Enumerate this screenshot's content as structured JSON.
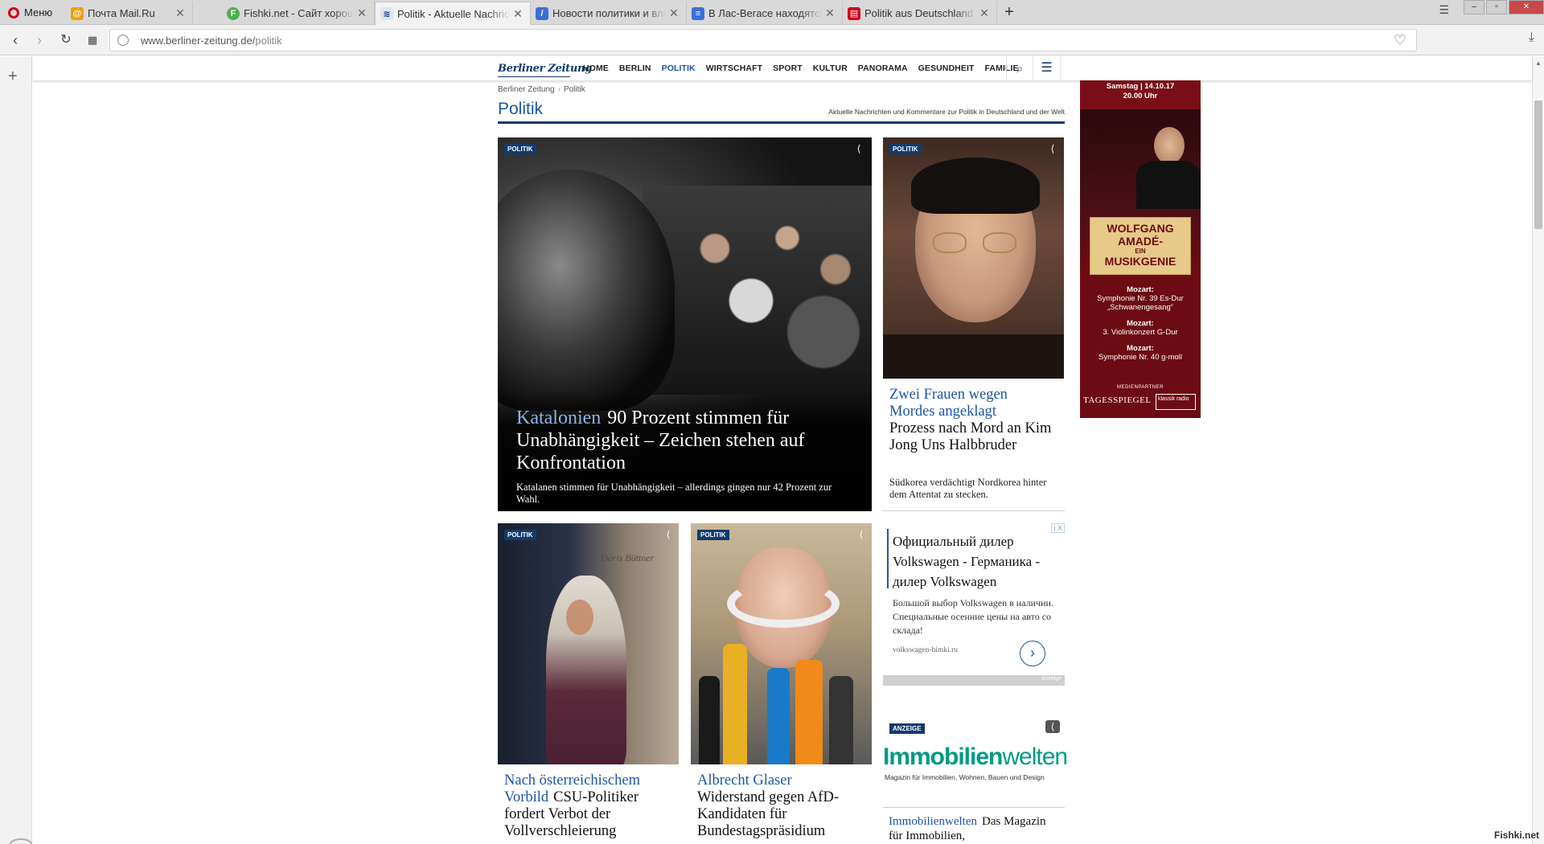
{
  "browser": {
    "menu_label": "Меню",
    "tabs": [
      {
        "title": "Почта Mail.Ru",
        "fav_color": "#f0a000"
      },
      {
        "title": "Fishki.net - Сайт хорошего",
        "fav_color": "#4caf50",
        "fav_letter": "F"
      },
      {
        "title": "Politik - Aktuelle Nachrichten",
        "fav_color": "#123b6d"
      },
      {
        "title": "Новости политики и власти",
        "fav_color": "#3b6fd8",
        "fav_letter": "/"
      },
      {
        "title": "В Лас-Вегасе находятся",
        "fav_color": "#3b6fd8"
      },
      {
        "title": "Politik aus Deutschland und",
        "fav_color": "#d0021b"
      }
    ],
    "url_host": "www.berliner-zeitung.de/",
    "url_path": "politik",
    "watermark": "Fishki.net"
  },
  "site": {
    "logo": "Berliner Zeitung",
    "nav": [
      "HOME",
      "BERLIN",
      "POLITIK",
      "WIRTSCHAFT",
      "SPORT",
      "KULTUR",
      "PANORAMA",
      "GESUNDHEIT",
      "FAMILIE"
    ],
    "breadcrumb": [
      "Berliner Zeitung",
      "Politik"
    ],
    "section_title": "Politik",
    "section_subtitle": "Aktuelle Nachrichten und Kommentare zur Politik in Deutschland und der Welt"
  },
  "articles": {
    "hero": {
      "tag": "POLITIK",
      "kicker": "Katalonien",
      "title": "90 Prozent stimmen für Unabhängigkeit – Zeichen stehen auf Konfrontation",
      "teaser": "Katalanen stimmen für Unabhängigkeit – allerdings gingen nur 42 Prozent zur Wahl."
    },
    "kim": {
      "tag": "POLITIK",
      "kicker": "Zwei Frauen wegen Mordes angeklagt",
      "title": "Prozess nach Mord an Kim Jong Uns Halbbruder",
      "teaser": "Südkorea verdächtigt Nordkorea hinter dem Attentat zu stecken."
    },
    "burka": {
      "tag": "POLITIK",
      "kicker": "Nach österreichischem Vorbild",
      "title": "CSU-Politiker fordert Verbot der Vollverschleierung",
      "shop_sign": "Doris Büttner"
    },
    "glaser": {
      "tag": "POLITIK",
      "kicker": "Albrecht Glaser",
      "title": "Widerstand gegen AfD-Kandidaten für Bundestagspräsidium"
    }
  },
  "ads": {
    "vw": {
      "headline": "Официальный дилер Volkswagen - Германика - дилер Volkswagen",
      "text": "Большой выбор Volkswagen в наличии. Специальные осенние цены на авто со склада!",
      "domain": "volkswagen-himki.ru",
      "footer": "Anzeige",
      "choice": "i X"
    },
    "concert": {
      "date": "Samstag | 14.10.17",
      "time": "20.00 Uhr",
      "headline_1": "WOLFGANG",
      "headline_2": "AMADÉ-",
      "headline_ein": "EIN",
      "headline_3": "MUSIKGENIE",
      "program": [
        {
          "composer": "Mozart:",
          "work": "Symphonie Nr. 39 Es-Dur „Schwanengesang“"
        },
        {
          "composer": "Mozart:",
          "work": "3. Violinkonzert G-Dur"
        },
        {
          "composer": "Mozart:",
          "work": "Symphonie Nr. 40 g-moll"
        }
      ],
      "partner_label": "MEDIENPARTNER",
      "partner_1": "TAGESSPIEGEL",
      "partner_2": "klassik radio"
    },
    "immo": {
      "tag": "ANZEIGE",
      "logo_a": "Immobilien",
      "logo_b": "welten",
      "subline": "Magazin für Immobilien, Wohnen, Bauen und Design",
      "kicker": "Immobilienwelten",
      "title": "Das Magazin für Immobilien,"
    }
  },
  "colors": {
    "brand": "#123b6d",
    "link": "#1c56a3",
    "immo": "#009a83",
    "concert": "#6d0b12"
  }
}
